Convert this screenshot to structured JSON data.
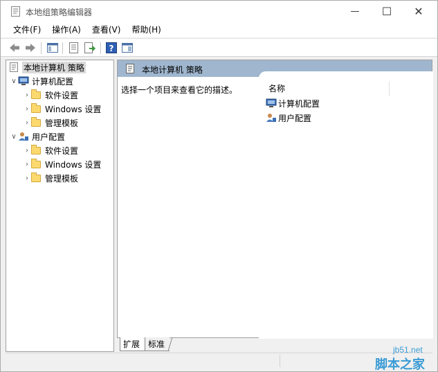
{
  "window": {
    "title": "本地组策略编辑器",
    "minimize_glyph": "—",
    "maximize_glyph": "☐",
    "close_glyph": "✕"
  },
  "menu": {
    "file": "文件(F)",
    "action": "操作(A)",
    "view": "查看(V)",
    "help": "帮助(H)"
  },
  "toolbar": {
    "icons": [
      "back-arrow-icon",
      "forward-arrow-icon",
      "show-hide-console-tree-icon",
      "properties-icon",
      "export-list-icon",
      "help-icon",
      "show-hide-action-pane-icon"
    ]
  },
  "tree": {
    "root": "本地计算机 策略",
    "computer_config": "计算机配置",
    "user_config": "用户配置",
    "children": {
      "software_settings": "软件设置",
      "windows_settings": "Windows 设置",
      "admin_templates": "管理模板"
    }
  },
  "content": {
    "header_title": "本地计算机 策略",
    "description": "选择一个项目来查看它的描述。",
    "column_name": "名称",
    "items": [
      "计算机配置",
      "用户配置"
    ]
  },
  "tabs": {
    "expand": "扩展",
    "standard": "标准"
  },
  "watermark": {
    "url": "jb51.net",
    "brand": "脚本之家"
  },
  "colors": {
    "header_bg": "#9fb6ce",
    "folder": "#fcd96f",
    "watermark": "#3a9bd5"
  }
}
